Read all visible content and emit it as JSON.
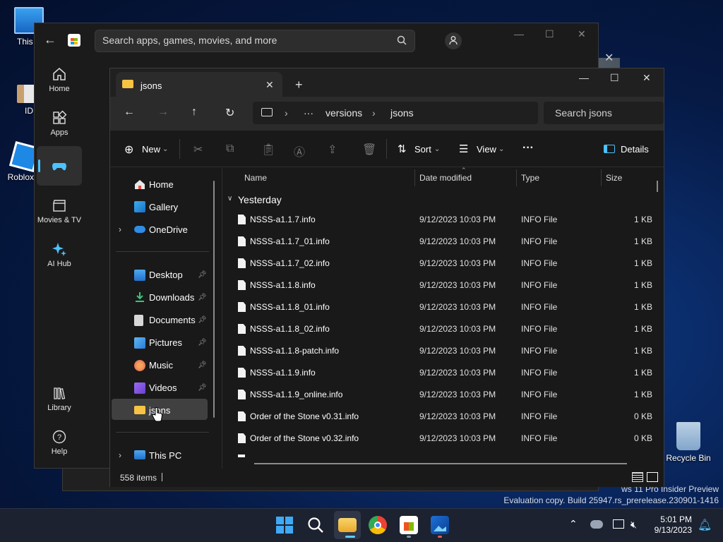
{
  "desktop": {
    "icons": [
      {
        "label": "This P"
      },
      {
        "label": "ID"
      },
      {
        "label": "Roblox S"
      },
      {
        "label": "Recycle Bin"
      }
    ],
    "watermark": {
      "line1": "ws 11 Pro Insider Preview",
      "line2": "Evaluation copy. Build 25947.rs_prerelease.230901-1416"
    }
  },
  "store": {
    "search_placeholder": "Search apps, games, movies, and more",
    "nav": [
      {
        "label": "Home"
      },
      {
        "label": "Apps"
      },
      {
        "label": "Gaming"
      },
      {
        "label": "Movies & TV"
      },
      {
        "label": "AI Hub"
      },
      {
        "label": "Library"
      },
      {
        "label": "Help"
      }
    ]
  },
  "explorer": {
    "tab_title": "jsons",
    "breadcrumb": [
      "versions",
      "jsons"
    ],
    "breadcrumb_overflow": "···",
    "search_placeholder": "Search jsons",
    "commands": {
      "new": "New",
      "sort": "Sort",
      "view": "View",
      "more": "···",
      "details": "Details"
    },
    "sidebar": {
      "top": [
        {
          "label": "Home"
        },
        {
          "label": "Gallery"
        },
        {
          "label": "OneDrive"
        }
      ],
      "pinned": [
        {
          "label": "Desktop"
        },
        {
          "label": "Downloads"
        },
        {
          "label": "Documents"
        },
        {
          "label": "Pictures"
        },
        {
          "label": "Music"
        },
        {
          "label": "Videos"
        },
        {
          "label": "jsons"
        }
      ],
      "bottom": [
        {
          "label": "This PC"
        }
      ]
    },
    "columns": {
      "name": "Name",
      "date": "Date modified",
      "type": "Type",
      "size": "Size"
    },
    "group": "Yesterday",
    "files": [
      {
        "name": "NSSS-a1.1.7.info",
        "date": "9/12/2023 10:03 PM",
        "type": "INFO File",
        "size": "1 KB"
      },
      {
        "name": "NSSS-a1.1.7_01.info",
        "date": "9/12/2023 10:03 PM",
        "type": "INFO File",
        "size": "1 KB"
      },
      {
        "name": "NSSS-a1.1.7_02.info",
        "date": "9/12/2023 10:03 PM",
        "type": "INFO File",
        "size": "1 KB"
      },
      {
        "name": "NSSS-a1.1.8.info",
        "date": "9/12/2023 10:03 PM",
        "type": "INFO File",
        "size": "1 KB"
      },
      {
        "name": "NSSS-a1.1.8_01.info",
        "date": "9/12/2023 10:03 PM",
        "type": "INFO File",
        "size": "1 KB"
      },
      {
        "name": "NSSS-a1.1.8_02.info",
        "date": "9/12/2023 10:03 PM",
        "type": "INFO File",
        "size": "1 KB"
      },
      {
        "name": "NSSS-a1.1.8-patch.info",
        "date": "9/12/2023 10:03 PM",
        "type": "INFO File",
        "size": "1 KB"
      },
      {
        "name": "NSSS-a1.1.9.info",
        "date": "9/12/2023 10:03 PM",
        "type": "INFO File",
        "size": "1 KB"
      },
      {
        "name": "NSSS-a1.1.9_online.info",
        "date": "9/12/2023 10:03 PM",
        "type": "INFO File",
        "size": "1 KB"
      },
      {
        "name": "Order of the Stone v0.31.info",
        "date": "9/12/2023 10:03 PM",
        "type": "INFO File",
        "size": "0 KB"
      },
      {
        "name": "Order of the Stone v0.32.info",
        "date": "9/12/2023 10:03 PM",
        "type": "INFO File",
        "size": "0 KB"
      }
    ],
    "status": "558 items"
  },
  "taskbar": {
    "time": "5:01 PM",
    "date": "9/13/2023"
  },
  "colors": {
    "accent": "#4cc2ff",
    "folder": "#f6c344",
    "onedrive": "#2f8de4"
  }
}
